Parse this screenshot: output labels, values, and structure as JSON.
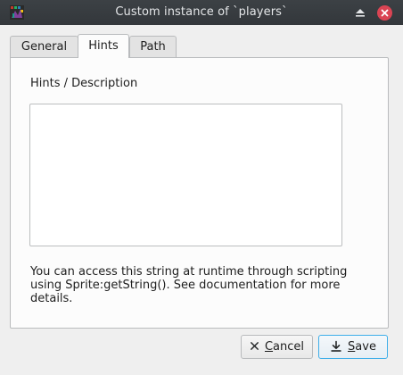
{
  "window": {
    "title": "Custom instance of `players`"
  },
  "tabs": [
    {
      "label": "General",
      "active": false
    },
    {
      "label": "Hints",
      "active": true
    },
    {
      "label": "Path",
      "active": false
    }
  ],
  "hints": {
    "section_label": "Hints / Description",
    "textarea_value": "",
    "help_text": "You can access this string at runtime through scripting using Sprite:getString(). See documentation for more details."
  },
  "buttons": {
    "cancel_mnemonic": "C",
    "cancel_rest": "ancel",
    "save_mnemonic": "S",
    "save_rest": "ave"
  },
  "colors": {
    "titlebar": "#33373b",
    "close_button": "#da4453",
    "focus_accent": "#3daee9"
  }
}
